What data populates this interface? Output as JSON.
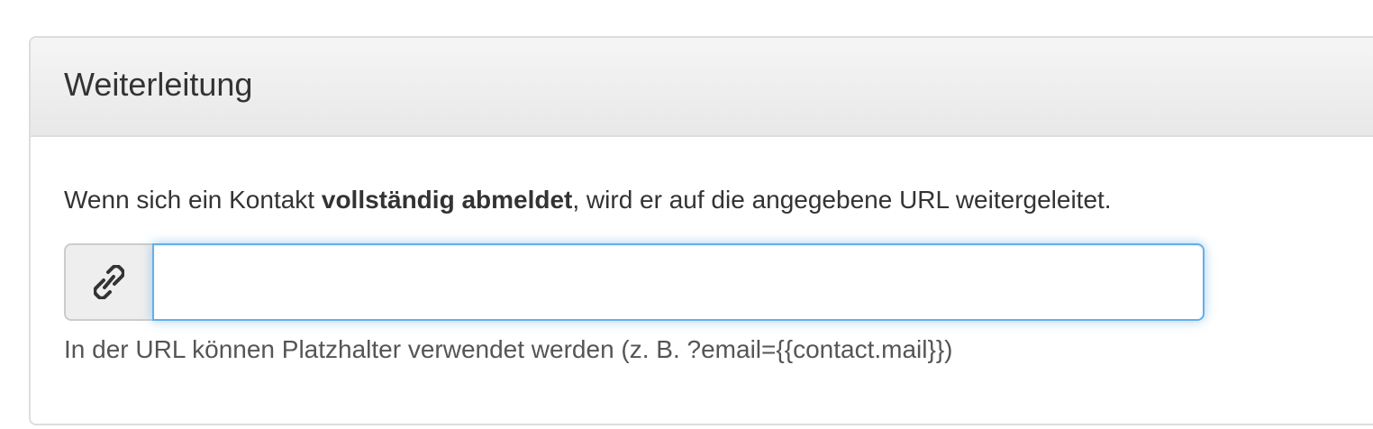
{
  "panel": {
    "title": "Weiterleitung"
  },
  "description": {
    "prefix": "Wenn sich ein Kontakt ",
    "bold": "vollständig abmeldet",
    "suffix": ", wird er auf die angegebene URL weitergeleitet."
  },
  "url_field": {
    "icon": "link-icon",
    "value": "",
    "placeholder": ""
  },
  "help_text": "In der URL können Platzhalter verwendet werden (z. B. ?email={{contact.mail}})",
  "colors": {
    "focus_border": "#66afe9",
    "heading_bg": "#f5f5f5",
    "addon_bg": "#eeeeee"
  }
}
